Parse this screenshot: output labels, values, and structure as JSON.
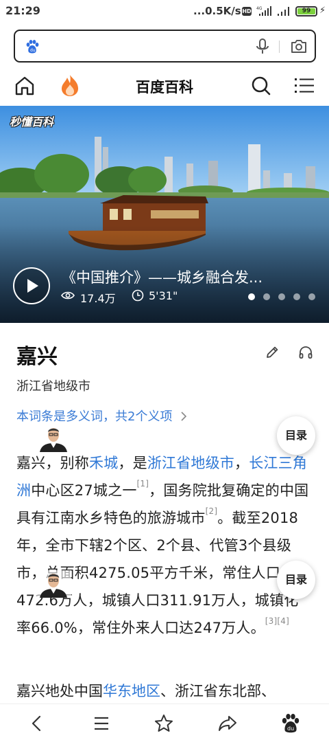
{
  "status_bar": {
    "time": "21:29",
    "net_speed": "...0.5K/s",
    "hd_badge": "HD",
    "network_type": "4G",
    "battery_level": "99"
  },
  "search": {
    "placeholder": ""
  },
  "header": {
    "title": "百度百科"
  },
  "video": {
    "brand": "秒懂百科",
    "title": "《中国推介》——城乡融合发...",
    "views": "17.4万",
    "duration": "5'31\"",
    "slide_count": 5,
    "active_slide": 1
  },
  "article": {
    "title": "嘉兴",
    "subtitle": "浙江省地级市",
    "polysemy_link": "本词条是多义词，共2个义项",
    "toc_label": "目录",
    "body": {
      "t1": "嘉兴，别称",
      "l1": "禾城",
      "t2": "，是",
      "l2": "浙江省地级市",
      "t3": "，",
      "l3": "长江三角洲",
      "t4": "中心区27城之一",
      "s1": "[1]",
      "t5": "，国务院批复确定的中国具有江南水乡特色的旅游城市",
      "s2": "[2]",
      "t6": "。截至2018年，全市下辖2个区、2个县、代管3个县级市，总面积4275.05平方千米，常住人口472.6万人，城镇人口311.91万人，城镇化率66.0%，常住外来人口达247万人。",
      "s3": "[3][4]"
    },
    "para2": {
      "t1": "嘉兴地处中国",
      "l1": "华东地区",
      "t2": "、浙江省东北部、"
    }
  },
  "colors": {
    "link": "#2f78d6",
    "accent": "#f47c2c",
    "baidu_blue": "#2f6ee0"
  }
}
